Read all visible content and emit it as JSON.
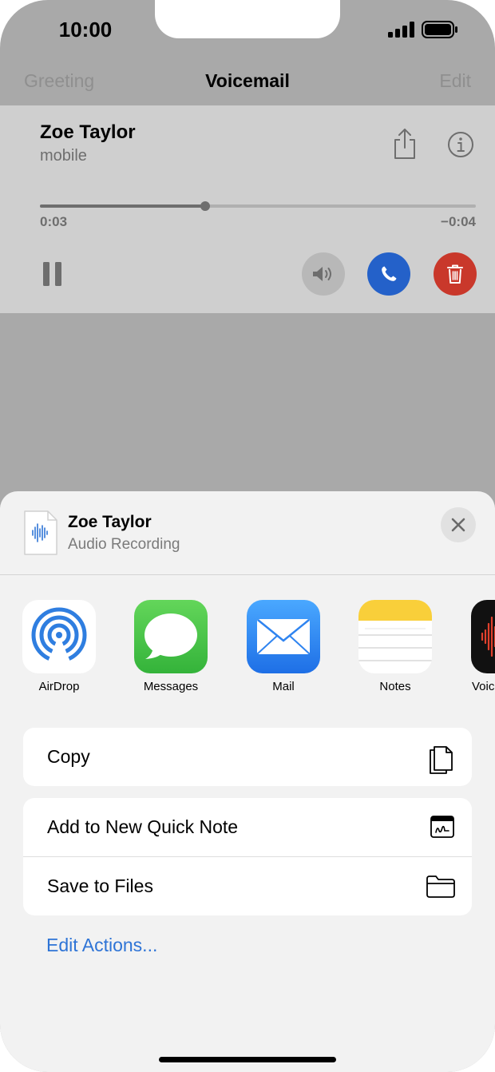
{
  "status": {
    "time": "10:00"
  },
  "nav": {
    "left": "Greeting",
    "title": "Voicemail",
    "right": "Edit"
  },
  "voicemail": {
    "name": "Zoe Taylor",
    "label": "mobile",
    "elapsed": "0:03",
    "remaining": "−0:04",
    "progress": 0.38
  },
  "sheet": {
    "title": "Zoe Taylor",
    "subtitle": "Audio Recording",
    "apps": [
      {
        "label": "AirDrop",
        "icon": "airdrop-icon"
      },
      {
        "label": "Messages",
        "icon": "messages-icon"
      },
      {
        "label": "Mail",
        "icon": "mail-icon"
      },
      {
        "label": "Notes",
        "icon": "notes-icon"
      },
      {
        "label": "Voice Memos",
        "icon": "voice-memos-icon"
      }
    ],
    "actions": {
      "copy": "Copy",
      "quick_note": "Add to New Quick Note",
      "save_files": "Save to Files"
    },
    "edit_actions": "Edit Actions..."
  },
  "colors": {
    "call": "#2461c9",
    "delete": "#c9382b",
    "link": "#2e74d6"
  }
}
